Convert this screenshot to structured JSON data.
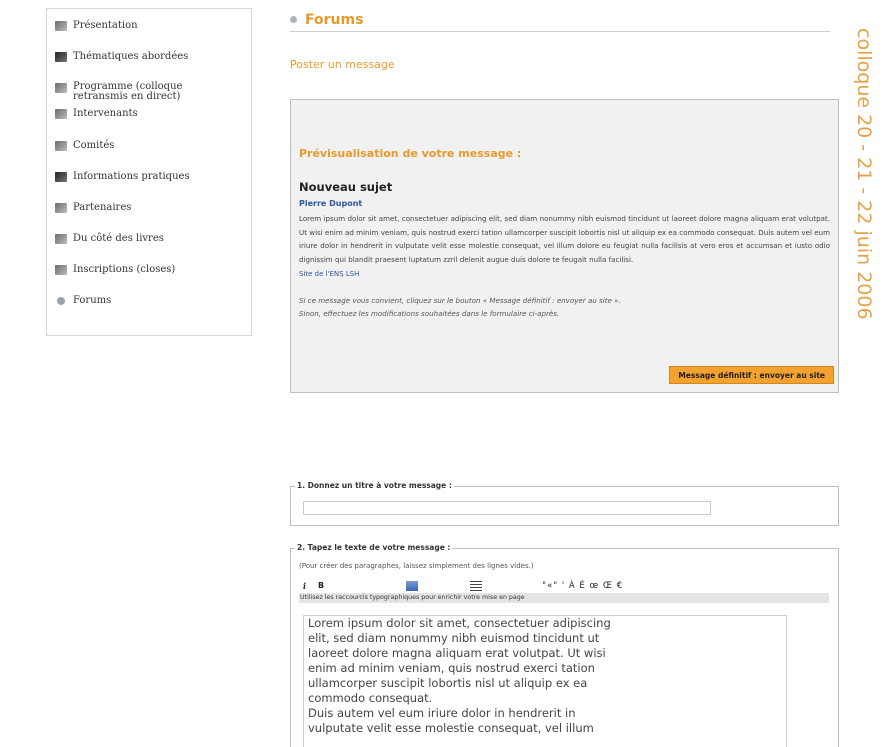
{
  "sidebar": {
    "items": [
      {
        "label": "Présentation",
        "icon": "presentation-icon"
      },
      {
        "label": "Thématiques abordées",
        "icon": "book-icon"
      },
      {
        "label": "Programme (colloque\nretransmis en direct)",
        "icon": "program-icon"
      },
      {
        "label": "Intervenants",
        "icon": "speakers-icon"
      },
      {
        "label": "Comités",
        "icon": "committee-icon"
      },
      {
        "label": "Informations pratiques",
        "icon": "pen-icon"
      },
      {
        "label": "Partenaires",
        "icon": "partners-icon"
      },
      {
        "label": "Du côté des livres",
        "icon": "books-icon"
      },
      {
        "label": "Inscriptions (closes)",
        "icon": "registration-icon"
      },
      {
        "label": "Forums",
        "icon": "bullet-icon"
      }
    ]
  },
  "header": {
    "title": "Forums"
  },
  "post_link": "Poster un message",
  "preview": {
    "heading": "Prévisualisation de votre message :",
    "subject": "Nouveau sujet",
    "author": "Pierre Dupont",
    "body": "Lorem ipsum dolor sit amet, consectetuer adipiscing elit, sed diam nonummy nibh euismod tincidunt ut laoreet dolore magna aliquam erat volutpat. Ut wisi enim ad minim veniam, quis nostrud exerci tation ullamcorper suscipit lobortis nisl ut aliquip ex ea commodo consequat. Duis autem vel eum iriure dolor in hendrerit in vulputate velit esse molestie consequat, vel illum dolore eu feugiat nulla facilisis at vero eros et accumsan et iusto odio dignissim qui blandit praesent luptatum zzril delenit augue duis dolore te feugait nulla facilisi.",
    "link": "Site de l'ENS LSH",
    "note_line1": "Si ce message vous convient, cliquez sur le bouton « Message définitif : envoyer au site ».",
    "note_line2": "Sinon, effectuez les modifications souhaitées dans le formulaire ci-après.",
    "final_button": "Message définitif : envoyer au site"
  },
  "form": {
    "step1_legend": "1. Donnez un titre à votre message :",
    "title_value": "",
    "step2_legend": "2. Tapez le texte de votre message :",
    "hint": "(Pour créer des paragraphes, laissez simplement des lignes vides.)",
    "toolbar": {
      "italic": "i",
      "bold": "B",
      "chars": "\"«\" ' À É œ Œ €"
    },
    "tip": "Utilisez les raccourcis typographiques pour enrichir votre mise en page",
    "text_value": "Lorem ipsum dolor sit amet, consectetuer adipiscing\nelit, sed diam nonummy nibh euismod tincidunt ut\nlaoreet dolore magna aliquam erat volutpat. Ut wisi\nenim ad minim veniam, quis nostrud exerci tation\nullamcorper suscipit lobortis nisl ut aliquip ex ea\ncommodo consequat.\nDuis autem vel eum iriure dolor in hendrerit in\nvulputate velit esse molestie consequat, vel illum"
  },
  "side_title": "colloque 20 - 21 - 22 juin 2006",
  "colors": {
    "accent": "#e79a2b",
    "link": "#2f56a3",
    "button": "#f3a22f",
    "side_text": "#e4a24a"
  }
}
